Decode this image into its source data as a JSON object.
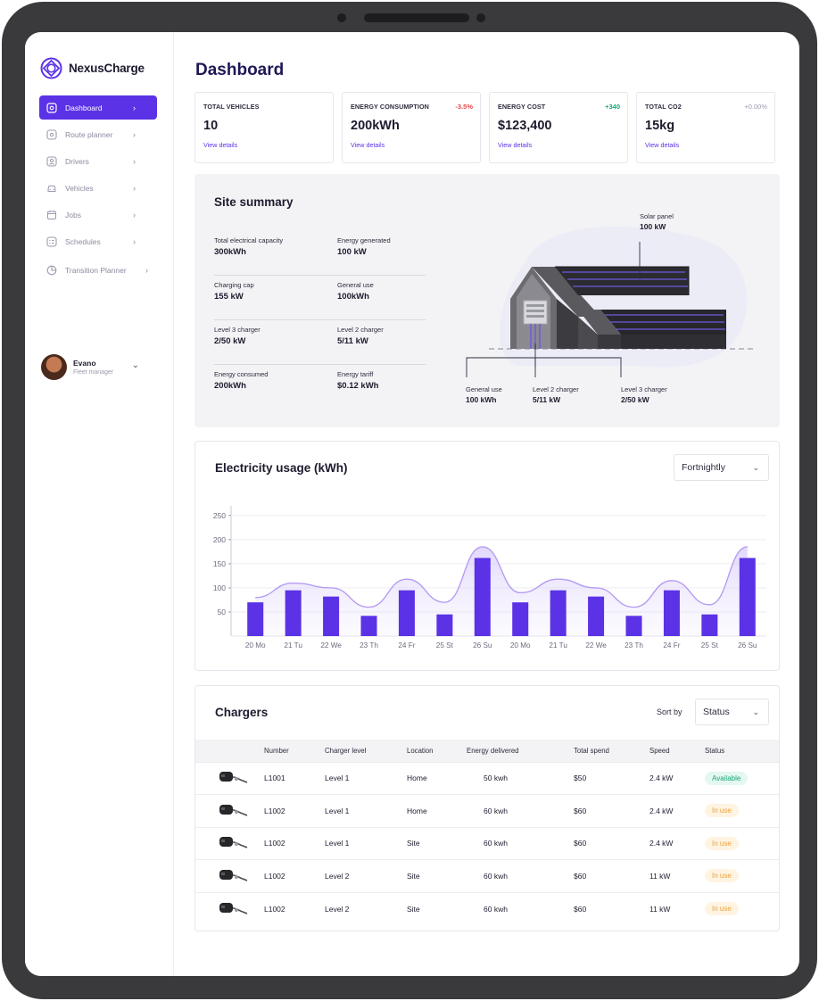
{
  "app": {
    "name": "NexusCharge"
  },
  "sidebar": {
    "items": [
      {
        "label": "Dashboard",
        "icon": "dashboard-icon",
        "active": true
      },
      {
        "label": "Route planner",
        "icon": "route-icon"
      },
      {
        "label": "Drivers",
        "icon": "driver-icon"
      },
      {
        "label": "Vehicles",
        "icon": "vehicle-icon"
      },
      {
        "label": "Jobs",
        "icon": "jobs-icon"
      },
      {
        "label": "Schedules",
        "icon": "schedule-icon"
      },
      {
        "label": "Transition Planner",
        "icon": "planner-icon"
      }
    ],
    "user": {
      "name": "Evano",
      "role": "Fleet manager"
    }
  },
  "page": {
    "title": "Dashboard"
  },
  "stats": [
    {
      "label": "TOTAL VEHICLES",
      "value": "10",
      "delta": "",
      "link": "View details"
    },
    {
      "label": "ENERGY CONSUMPTION",
      "value": "200kWh",
      "delta": "-3.5%",
      "delta_color": "#e5484d",
      "link": "View details"
    },
    {
      "label": "ENERGY COST",
      "value": "$123,400",
      "delta": "+340",
      "delta_color": "#1aa57a",
      "link": "View details"
    },
    {
      "label": "TOTAL CO2",
      "value": "15kg",
      "delta": "+0.00%",
      "delta_color": "#9a9aae",
      "link": "View details"
    }
  ],
  "site_summary": {
    "title": "Site summary",
    "rows": [
      [
        {
          "label": "Total electrical capacity",
          "value": "300kWh"
        },
        {
          "label": "Energy generated",
          "value": "100 kW"
        }
      ],
      [
        {
          "label": "Charging cap",
          "value": "155 kW"
        },
        {
          "label": "General use",
          "value": "100kWh"
        }
      ],
      [
        {
          "label": "Level 3 charger",
          "value": "2/50 kW"
        },
        {
          "label": "Level 2 charger",
          "value": "5/11 kW"
        }
      ],
      [
        {
          "label": "Energy consumed",
          "value": "200kWh"
        },
        {
          "label": "Energy tariff",
          "value": "$0.12 kWh"
        }
      ]
    ],
    "diagram": {
      "solar": {
        "label": "Solar panel",
        "value": "100 kW"
      },
      "general": {
        "label": "General use",
        "value": "100 kWh"
      },
      "level2": {
        "label": "Level 2 charger",
        "value": "5/11 kW"
      },
      "level3": {
        "label": "Level 3 charger",
        "value": "2/50 kW"
      }
    }
  },
  "usage": {
    "title": "Electricity usage (kWh)",
    "period": "Fortnightly"
  },
  "chart_data": {
    "type": "bar",
    "title": "Electricity usage (kWh)",
    "categories": [
      "20 Mo",
      "21 Tu",
      "22 We",
      "23 Th",
      "24 Fr",
      "25 St",
      "26 Su",
      "20 Mo",
      "21 Tu",
      "22 We",
      "23 Th",
      "24 Fr",
      "25 St",
      "26 Su"
    ],
    "values": [
      70,
      95,
      82,
      42,
      95,
      45,
      162,
      70,
      95,
      82,
      42,
      95,
      45,
      162
    ],
    "trend": [
      80,
      110,
      100,
      60,
      118,
      70,
      185,
      90,
      118,
      100,
      60,
      115,
      65,
      185
    ],
    "yticks": [
      50,
      100,
      150,
      200,
      250
    ],
    "ylim": [
      0,
      270
    ],
    "colors": {
      "bar": "#5b32e6",
      "line": "#b69cf3"
    }
  },
  "chargers": {
    "title": "Chargers",
    "sort_label": "Sort by",
    "sort_value": "Status",
    "columns": [
      "Number",
      "Charger level",
      "Location",
      "Energy delivered",
      "Total spend",
      "Speed",
      "Status"
    ],
    "rows": [
      {
        "number": "L1001",
        "level": "Level 1",
        "location": "Home",
        "energy": "50 kwh",
        "spend": "$50",
        "speed": "2.4 kW",
        "status": "Available"
      },
      {
        "number": "L1002",
        "level": "Level 1",
        "location": "Home",
        "energy": "60 kwh",
        "spend": "$60",
        "speed": "2.4 kW",
        "status": "In use"
      },
      {
        "number": "L1002",
        "level": "Level 1",
        "location": "Site",
        "energy": "60 kwh",
        "spend": "$60",
        "speed": "2.4 kW",
        "status": "In use"
      },
      {
        "number": "L1002",
        "level": "Level 2",
        "location": "Site",
        "energy": "60 kwh",
        "spend": "$60",
        "speed": "11 kW",
        "status": "In use"
      },
      {
        "number": "L1002",
        "level": "Level 2",
        "location": "Site",
        "energy": "60 kwh",
        "spend": "$60",
        "speed": "11 kW",
        "status": "In use"
      }
    ]
  }
}
